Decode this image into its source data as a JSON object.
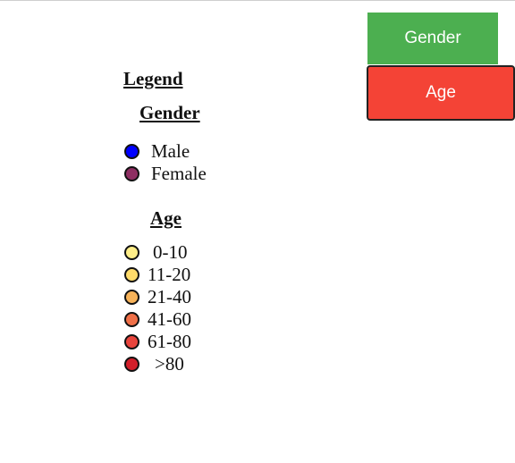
{
  "buttons": {
    "gender_label": "Gender",
    "age_label": "Age"
  },
  "legend": {
    "title": "Legend",
    "gender": {
      "heading": "Gender",
      "items": [
        {
          "label": "Male",
          "color": "#0000ff"
        },
        {
          "label": "Female",
          "color": "#8e2e62"
        }
      ]
    },
    "age": {
      "heading": "Age",
      "items": [
        {
          "label": "0-10",
          "color": "#ffee88"
        },
        {
          "label": "11-20",
          "color": "#fedb6a"
        },
        {
          "label": "21-40",
          "color": "#f7b35a"
        },
        {
          "label": "41-60",
          "color": "#f07048"
        },
        {
          "label": "61-80",
          "color": "#e8443c"
        },
        {
          "label": ">80",
          "color": "#d21f2a"
        }
      ]
    }
  },
  "colors": {
    "gender_button": "#4caf50",
    "age_button": "#f44336"
  }
}
